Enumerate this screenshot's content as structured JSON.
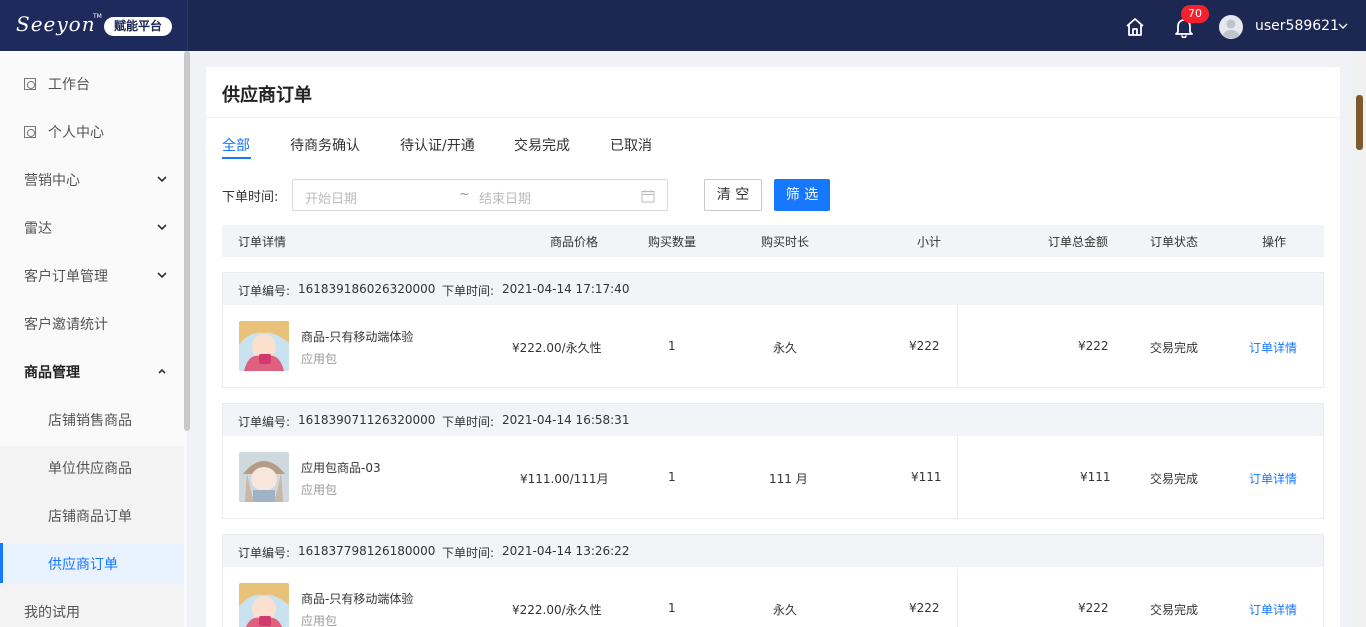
{
  "header": {
    "logo_text": "Seeyon",
    "logo_tm": "TM",
    "platform_badge": "赋能平台",
    "notification_count": "70",
    "username": "user589621",
    "icons": [
      "home-icon",
      "bell-icon",
      "avatar-icon",
      "chevron-down-icon"
    ]
  },
  "sidebar": {
    "items": [
      {
        "label": "工作台",
        "icon": "workbench-icon"
      },
      {
        "label": "个人中心",
        "icon": "user-center-icon"
      },
      {
        "label": "营销中心",
        "expandable": true
      },
      {
        "label": "雷达",
        "expandable": true
      },
      {
        "label": "客户订单管理",
        "expandable": true
      },
      {
        "label": "客户邀请统计"
      },
      {
        "label": "商品管理",
        "expanded": true
      },
      {
        "label": "店铺销售商品"
      },
      {
        "label": "单位供应商品"
      },
      {
        "label": "店铺商品订单"
      },
      {
        "label": "供应商订单",
        "active": true
      },
      {
        "label": "我的试用"
      }
    ]
  },
  "main": {
    "title": "供应商订单",
    "tabs": [
      "全部",
      "待商务确认",
      "待认证/开通",
      "交易完成",
      "已取消"
    ],
    "active_tab": "全部",
    "filter": {
      "label": "下单时间:",
      "start_placeholder": "开始日期",
      "separator": "~",
      "end_placeholder": "结束日期",
      "clear_label": "清 空",
      "filter_label": "筛 选"
    },
    "columns": [
      "订单详情",
      "商品价格",
      "购买数量",
      "购买时长",
      "小计",
      "订单总金额",
      "订单状态",
      "操作"
    ],
    "order_no_label": "订单编号:",
    "order_time_label": "下单时间:",
    "orders": [
      {
        "order_no": "161839186026320000",
        "time": "2021-04-14 17:17:40",
        "name": "商品-只有移动端体验",
        "type": "应用包",
        "price": "¥222.00/永久性",
        "qty": "1",
        "duration": "永久",
        "subtotal": "¥222",
        "total": "¥222",
        "status": "交易完成",
        "action": "订单详情"
      },
      {
        "order_no": "161839071126320000",
        "time": "2021-04-14 16:58:31",
        "name": "应用包商品-03",
        "type": "应用包",
        "price": "¥111.00/111月",
        "qty": "1",
        "duration": "111 月",
        "subtotal": "¥111",
        "total": "¥111",
        "status": "交易完成",
        "action": "订单详情"
      },
      {
        "order_no": "161837798126180000",
        "time": "2021-04-14 13:26:22",
        "name": "商品-只有移动端体验",
        "type": "应用包",
        "price": "¥222.00/永久性",
        "qty": "1",
        "duration": "永久",
        "subtotal": "¥222",
        "total": "¥222",
        "status": "交易完成",
        "action": "订单详情"
      }
    ]
  },
  "colors": {
    "topbar": "#1c2752",
    "accent": "#1677ff",
    "badge": "#f5222d"
  }
}
